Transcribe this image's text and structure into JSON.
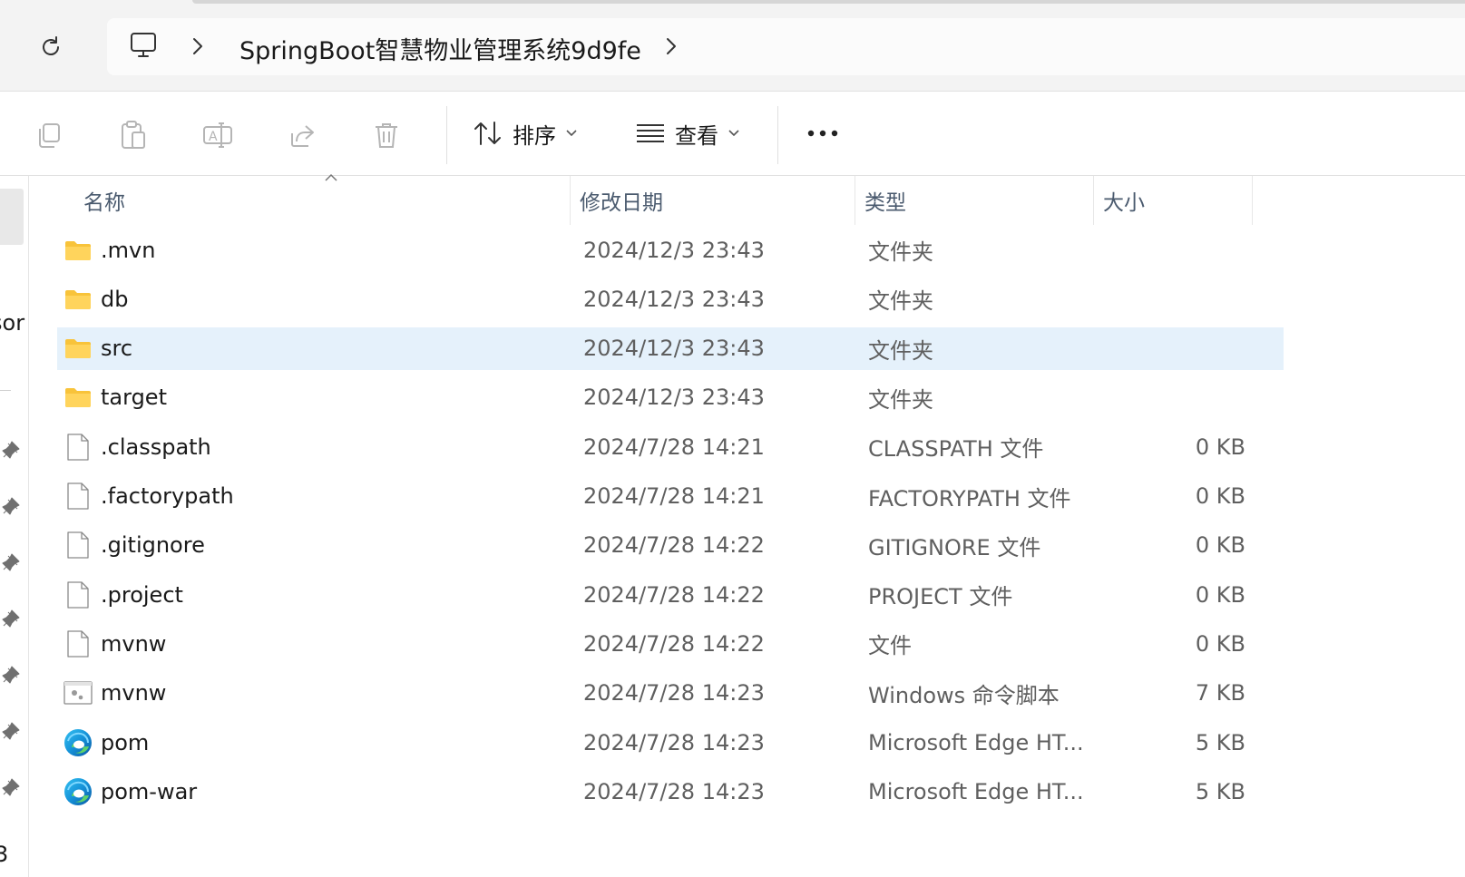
{
  "address_bar": {
    "path": "SpringBoot智慧物业管理系统9d9fe",
    "this_pc_icon": "monitor-icon",
    "refresh_icon": "refresh-icon"
  },
  "toolbar": {
    "copy_icon": "copy-icon",
    "paste_icon": "paste-icon",
    "rename_icon": "rename-icon",
    "share_icon": "share-icon",
    "delete_icon": "trash-icon",
    "sort_label": "排序",
    "view_label": "查看",
    "more_icon": "more-horizontal-icon"
  },
  "nav_pane": {
    "partial_label_1": "sor",
    "partial_label_2": "3",
    "pin_icon": "pin-icon"
  },
  "columns": {
    "name": "名称",
    "date": "修改日期",
    "type": "类型",
    "size": "大小"
  },
  "files": [
    {
      "name": ".mvn",
      "date": "2024/12/3 23:43",
      "type": "文件夹",
      "size": "",
      "icon": "folder-icon"
    },
    {
      "name": "db",
      "date": "2024/12/3 23:43",
      "type": "文件夹",
      "size": "",
      "icon": "folder-icon"
    },
    {
      "name": "src",
      "date": "2024/12/3 23:43",
      "type": "文件夹",
      "size": "",
      "icon": "folder-icon",
      "selected": true
    },
    {
      "name": "target",
      "date": "2024/12/3 23:43",
      "type": "文件夹",
      "size": "",
      "icon": "folder-icon"
    },
    {
      "name": ".classpath",
      "date": "2024/7/28 14:21",
      "type": "CLASSPATH 文件",
      "size": "0 KB",
      "icon": "file-icon"
    },
    {
      "name": ".factorypath",
      "date": "2024/7/28 14:21",
      "type": "FACTORYPATH 文件",
      "size": "0 KB",
      "icon": "file-icon"
    },
    {
      "name": ".gitignore",
      "date": "2024/7/28 14:22",
      "type": "GITIGNORE 文件",
      "size": "0 KB",
      "icon": "file-icon"
    },
    {
      "name": ".project",
      "date": "2024/7/28 14:22",
      "type": "PROJECT 文件",
      "size": "0 KB",
      "icon": "file-icon"
    },
    {
      "name": "mvnw",
      "date": "2024/7/28 14:22",
      "type": "文件",
      "size": "0 KB",
      "icon": "file-icon"
    },
    {
      "name": "mvnw",
      "date": "2024/7/28 14:23",
      "type": "Windows 命令脚本",
      "size": "7 KB",
      "icon": "cmd-script-icon"
    },
    {
      "name": "pom",
      "date": "2024/7/28 14:23",
      "type": "Microsoft Edge HT...",
      "size": "5 KB",
      "icon": "edge-icon"
    },
    {
      "name": "pom-war",
      "date": "2024/7/28 14:23",
      "type": "Microsoft Edge HT...",
      "size": "5 KB",
      "icon": "edge-icon"
    }
  ],
  "colors": {
    "selection": "#e5f1fb",
    "folder": "#f8c33a",
    "header_text": "#4a5a6e",
    "secondary_text": "#5f5f5f"
  }
}
